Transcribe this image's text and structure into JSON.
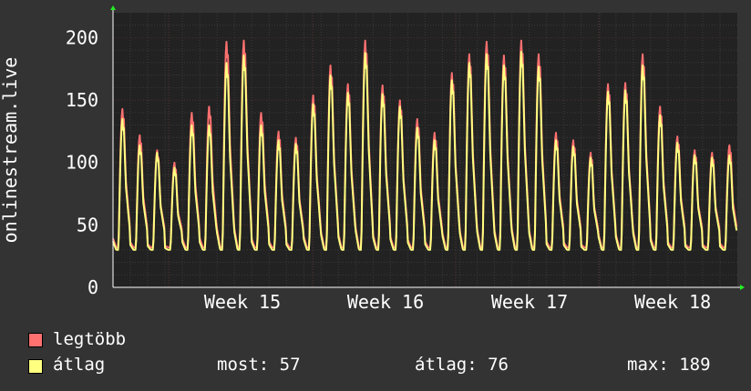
{
  "chart_data": {
    "type": "line",
    "ylabel": "onlinestream.live",
    "ylim": [
      0,
      220
    ],
    "yticks": [
      0,
      50,
      100,
      150,
      200
    ],
    "xticks": [
      "Week  15",
      "Week  16",
      "Week  17",
      "Week  18"
    ],
    "grid": true,
    "background": "#222222",
    "page_background": "#333333",
    "grid_color": "#444444",
    "series": [
      {
        "name": "legtöbb",
        "color": "#ff7070",
        "daily_peaks": [
          143,
          122,
          110,
          100,
          140,
          145,
          197,
          198,
          140,
          125,
          120,
          154,
          178,
          163,
          198,
          162,
          150,
          135,
          124,
          172,
          187,
          197,
          186,
          198,
          187,
          124,
          118,
          108,
          163,
          164,
          187,
          145,
          121,
          110,
          108,
          114
        ]
      },
      {
        "name": "átlag",
        "color": "#ffff80",
        "daily_peaks": [
          135,
          114,
          108,
          96,
          130,
          130,
          180,
          186,
          130,
          118,
          115,
          147,
          170,
          156,
          188,
          155,
          145,
          128,
          118,
          166,
          180,
          187,
          178,
          189,
          177,
          118,
          113,
          104,
          157,
          158,
          178,
          138,
          116,
          106,
          104,
          106
        ]
      }
    ]
  },
  "legend": {
    "max_label": "legtöbb",
    "avg_label": "átlag",
    "max_color": "#ff7070",
    "avg_color": "#ffff80"
  },
  "stats": {
    "now": "most: 57",
    "avg": "átlag: 76",
    "max": "max: 189"
  }
}
